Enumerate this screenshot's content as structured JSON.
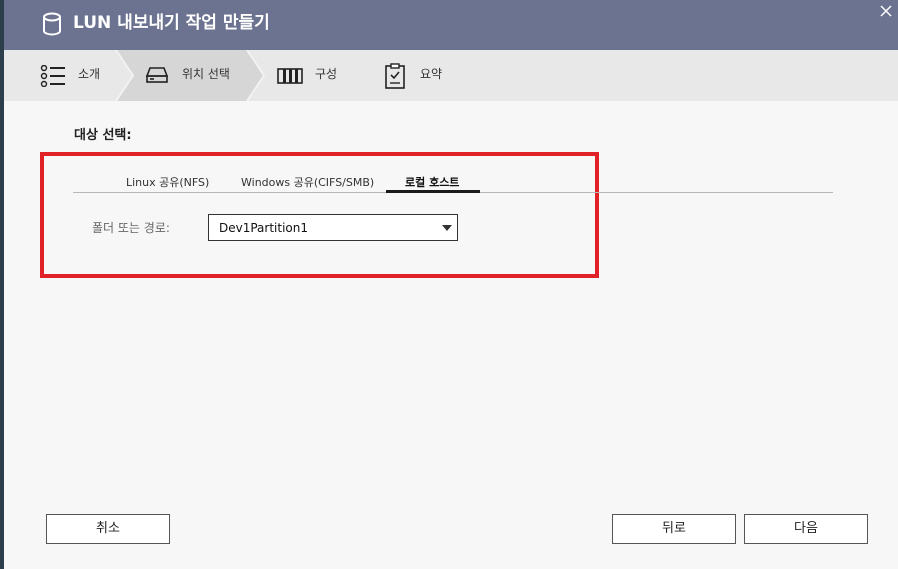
{
  "dialog": {
    "title": "LUN 내보내기 작업 만들기"
  },
  "steps": [
    {
      "label": "소개",
      "icon": "list-icon"
    },
    {
      "label": "위치 선택",
      "icon": "drive-icon",
      "active": true
    },
    {
      "label": "구성",
      "icon": "settings-bars-icon"
    },
    {
      "label": "요약",
      "icon": "clipboard-icon"
    }
  ],
  "main": {
    "section_title": "대상 선택:",
    "tabs": [
      {
        "label": "Linux 공유(NFS)"
      },
      {
        "label": "Windows 공유(CIFS/SMB)"
      },
      {
        "label": "로컬 호스트",
        "active": true
      }
    ],
    "folder_label": "폴더 또는 경로:",
    "folder_value": "Dev1Partition1"
  },
  "buttons": {
    "cancel": "취소",
    "back": "뒤로",
    "next": "다음"
  },
  "colors": {
    "titlebar": "#6c7390",
    "highlight": "#e02128",
    "active_step": "#d6d6d6"
  }
}
